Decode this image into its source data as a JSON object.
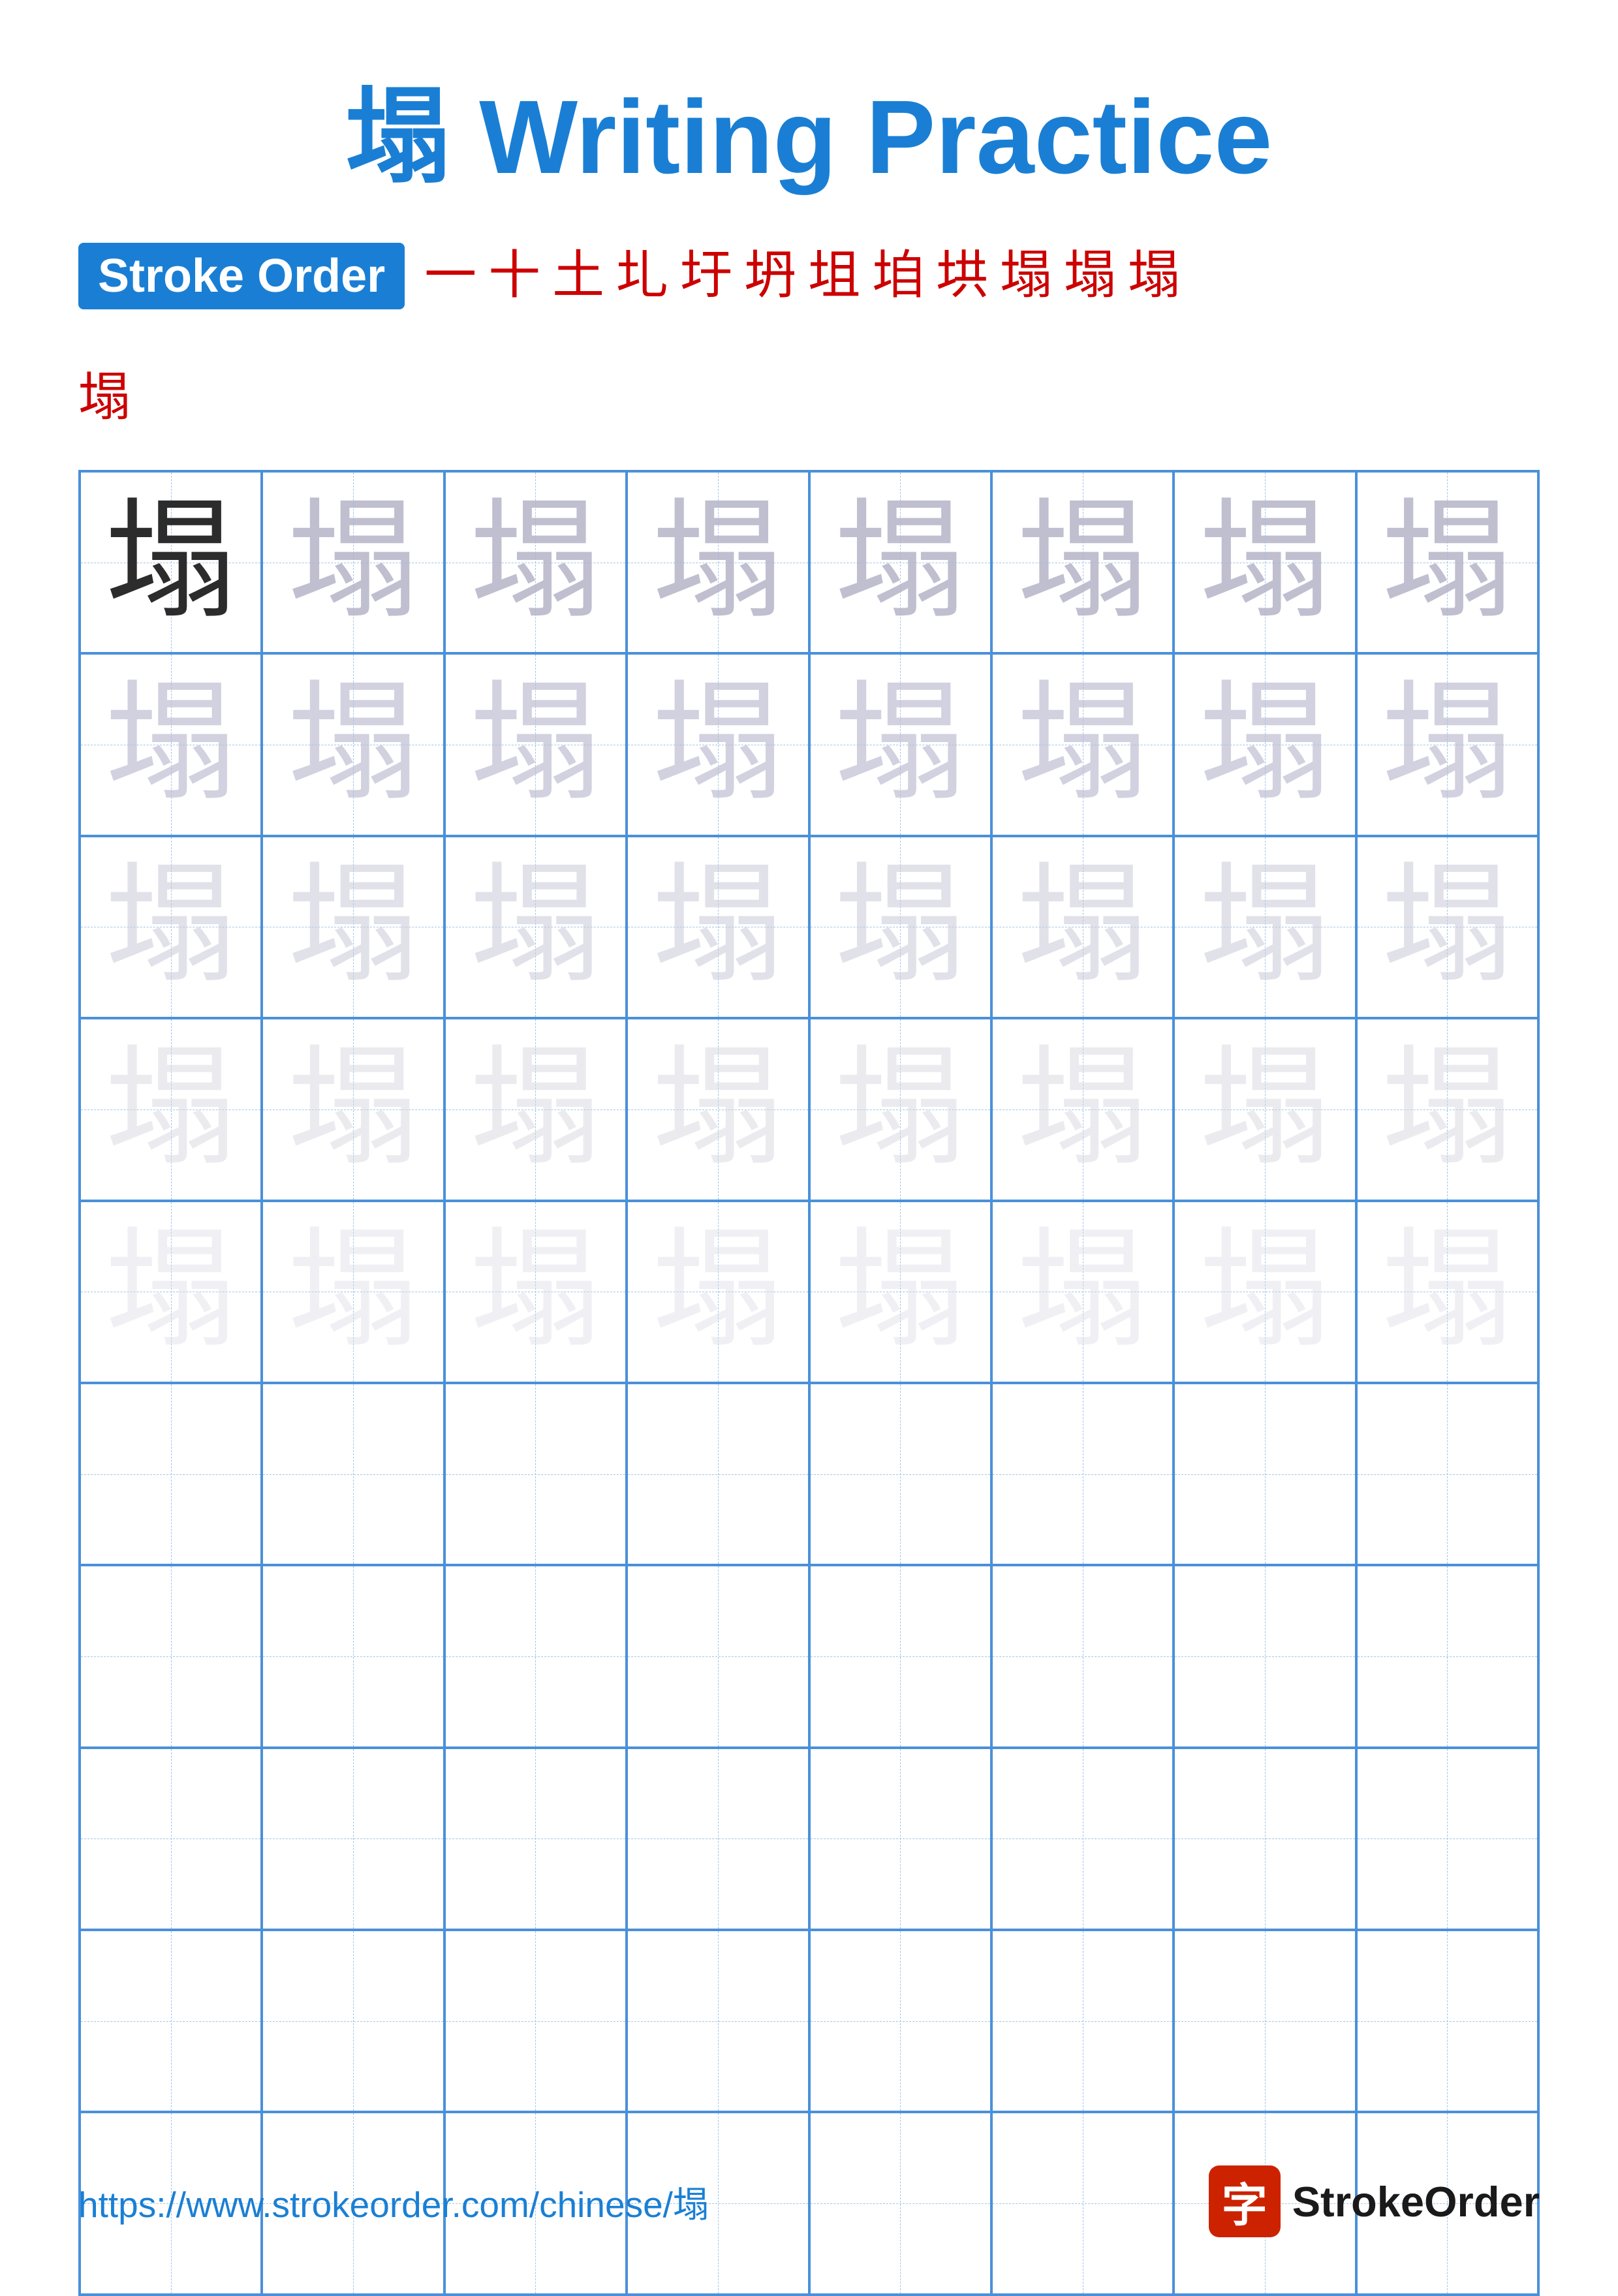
{
  "title": "塌 Writing Practice",
  "stroke_order_label": "Stroke Order",
  "character": "塌",
  "stroke_sequence": [
    "一",
    "十",
    "土",
    "圠",
    "圩",
    "坍",
    "坥",
    "垍",
    "垬",
    "塌",
    "塌",
    "塌"
  ],
  "stroke_overflow": "塌",
  "grid": {
    "rows": 10,
    "cols": 8,
    "filled_rows": 5,
    "char": "塌"
  },
  "footer": {
    "url": "https://www.strokeorder.com/chinese/塌",
    "logo_char": "字",
    "logo_name": "StrokeOrder"
  }
}
